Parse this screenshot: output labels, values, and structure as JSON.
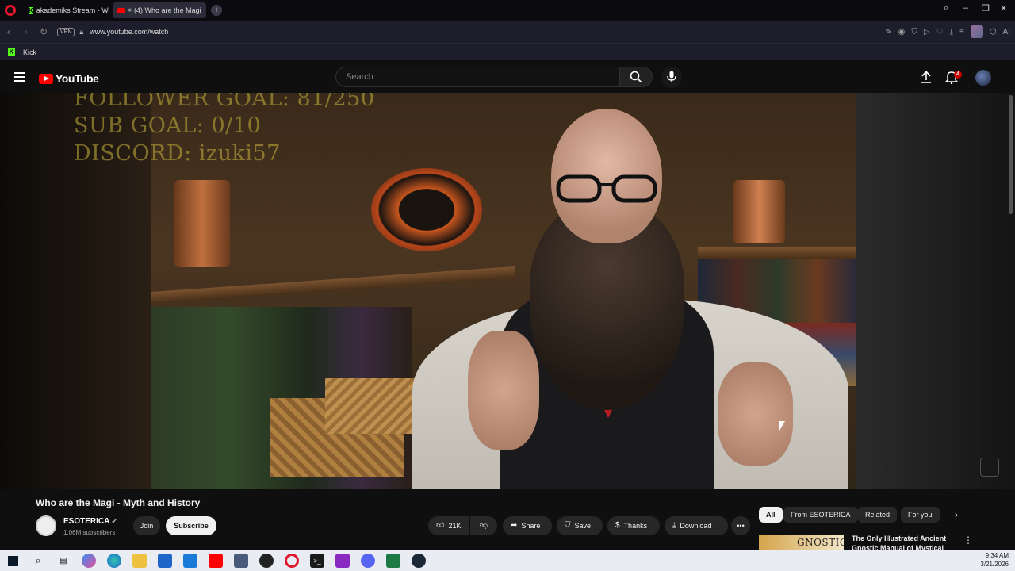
{
  "browser": {
    "tabs": [
      {
        "label": "akademiks Stream - Watch"
      },
      {
        "label": "(4) Who are the Magi"
      }
    ],
    "url": "www.youtube.com/watch",
    "vpn_label": "VPN",
    "ai_label": "AI",
    "bookmarks": [
      {
        "label": "Kick"
      }
    ]
  },
  "youtube": {
    "logo_text": "YouTube",
    "search_placeholder": "Search",
    "notification_count": "4"
  },
  "video": {
    "overlay_lines": [
      "FOLLOWER GOAL:  81/250",
      "SUB GOAL: 0/10",
      "DISCORD: izuki57"
    ],
    "title": "Who are the Magi - Myth and History"
  },
  "channel": {
    "name": "ESOTERICA",
    "subscribers": "1.06M subscribers",
    "join_label": "Join",
    "subscribe_label": "Subscribe"
  },
  "actions": {
    "like_count": "21K",
    "share_label": "Share",
    "save_label": "Save",
    "thanks_label": "Thanks",
    "download_label": "Download"
  },
  "chips": [
    {
      "label": "All"
    },
    {
      "label": "From ESOTERICA"
    },
    {
      "label": "Related"
    },
    {
      "label": "For you"
    }
  ],
  "recommendation": {
    "thumb_text": "GNOSTIC",
    "title": "The Only Illustrated Ancient Gnostic Manual of Mystical"
  },
  "taskbar": {
    "time": "9:34 AM",
    "date": "3/21/2026"
  },
  "colors": {
    "youtube_red": "#ff0000",
    "opera_red": "#e0162b",
    "kick_green": "#53fc18",
    "overlay_text": "#c8b43c"
  }
}
